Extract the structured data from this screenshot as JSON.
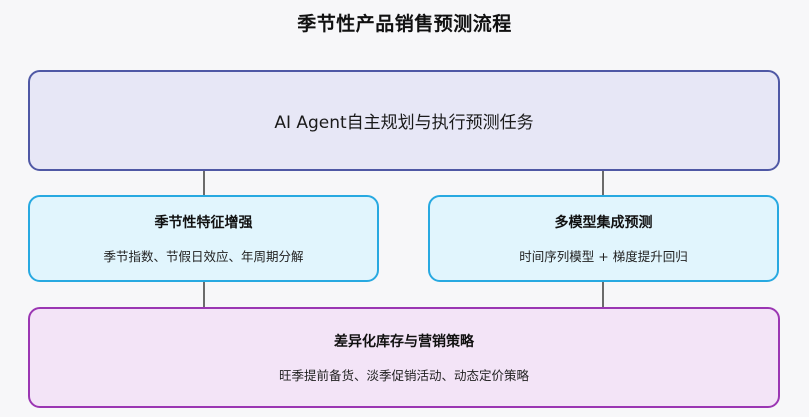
{
  "diagram": {
    "title": "季节性产品销售预测流程",
    "agent_node": {
      "label": "AI Agent自主规划与执行预测任务"
    },
    "left_node": {
      "heading": "季节性特征增强",
      "description": "季节指数、节假日效应、年周期分解"
    },
    "right_node": {
      "heading": "多模型集成预测",
      "description": "时间序列模型 + 梯度提升回归"
    },
    "bottom_node": {
      "heading": "差异化库存与营销策略",
      "description": "旺季提前备货、淡季促销活动、动态定价策略"
    },
    "colors": {
      "agent_fill": "#e7e7f6",
      "agent_border": "#4f58a5",
      "feature_fill": "#e1f5fd",
      "feature_border": "#27a9e1",
      "strategy_fill": "#f3e4f7",
      "strategy_border": "#9b36b3"
    }
  }
}
